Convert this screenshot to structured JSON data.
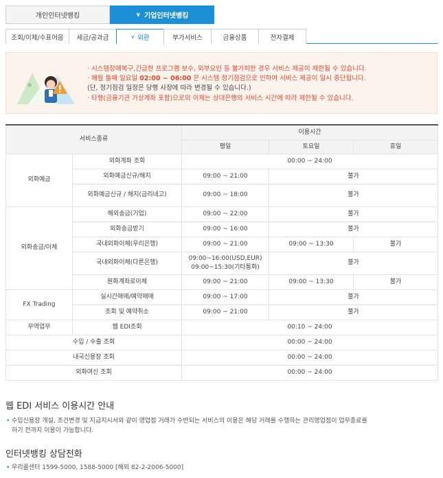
{
  "top_tabs": [
    {
      "label": "개인인터넷뱅킹",
      "active": false
    },
    {
      "label": "기업인터넷뱅킹",
      "active": true
    }
  ],
  "sub_tabs": [
    {
      "label": "조회/이체/수표어음",
      "active": false
    },
    {
      "label": "세금/공과금",
      "active": false
    },
    {
      "label": "외환",
      "active": true
    },
    {
      "label": "부가서비스",
      "active": false
    },
    {
      "label": "금융상품",
      "active": false
    },
    {
      "label": "전자결제",
      "active": false
    }
  ],
  "notice": {
    "line1": "· 시스템장애복구,긴급한 프로그램 보수, 외부요인 등 불가피한 경우 서비스 제공이 제한될 수 있습니다.",
    "line2_a": "· 매월 둘째 일요일 ",
    "line2_b": "02:00 ~ 06:00",
    "line2_c": " 은 시스템 정기점검으로 인하여 서비스 제공이 일시 중단됩니다.",
    "line3": "(단, 정기점검 일정은 당행 사정에 따라 변경될 수 있습니다.)",
    "line4": "· 타행(금융기관 가상계좌 포함)으로의 이체는 상대은행의 서비스 시간에 따라 제한될 수 있습니다."
  },
  "table": {
    "col_service": "서비스종류",
    "col_hours": "이용시간",
    "col_weekday": "평일",
    "col_saturday": "토요일",
    "col_holiday": "휴일",
    "groups": {
      "fx_deposit": "외화예금",
      "fx_remit": "외화송금/이체",
      "fx_trading": "FX Trading",
      "trade": "무역업무"
    },
    "rows": {
      "r1": {
        "service": "외화계좌 조회",
        "all": "00:00 ~ 24:00"
      },
      "r2": {
        "service": "외화예금신규/해지",
        "weekday": "09:00 ~ 21:00",
        "rest": "불가"
      },
      "r3": {
        "service": "외화예금신규 / 해지(금리네고)",
        "weekday": "09:00 ~ 18:00",
        "rest": "불가"
      },
      "r4": {
        "service": "해외송금(기업)",
        "weekday": "09:00 ~ 22:00",
        "rest": "불가"
      },
      "r5": {
        "service": "외화송금받기",
        "weekday": "09:00 ~ 16:00",
        "rest": "불가"
      },
      "r6": {
        "service": "국내외화이체(우리은행)",
        "weekday": "09:00 ~ 21:00",
        "saturday": "09:00 ~ 13:30",
        "holiday": "불가"
      },
      "r7": {
        "service": "국내외화이체(다른은행)",
        "weekday_1": "09:00~16:00(USD,EUR)",
        "weekday_2": "09:00~15:30(기타통화)",
        "rest": "불가"
      },
      "r8": {
        "service": "원화계좌로이체",
        "weekday": "09:00 ~ 21:00",
        "saturday": "09:00 ~ 13:30",
        "holiday": "불가"
      },
      "r9": {
        "service": "실시간매매/예약매매",
        "weekday": "09:00 ~ 17:00",
        "rest": "불가"
      },
      "r10": {
        "service": "조회 및 예약취소",
        "weekday": "09:00 ~ 21:00",
        "rest": "불가"
      },
      "r11": {
        "service": "웹 EDI조회",
        "all": "00:10 ~ 24:00"
      },
      "r12": {
        "service": "수입 / 수출 조회",
        "all": "00:00 ~ 24:00"
      },
      "r13": {
        "service": "내국신용장 조회",
        "all": "00:00 ~ 24:00"
      },
      "r14": {
        "service": "외화여신 조회",
        "all": "00:00 ~ 24:00"
      }
    }
  },
  "edi_section": {
    "title": "웹 EDI 서비스 이용시간 안내",
    "text_1": "수입신용장 개설, 조건변경 및 지급지시서와 같이 영업점 거래가 수반되는 서비스의 이용은 해당 거래를 수행하는 관리영업점이 업무종료를",
    "text_2": "하기 전까지 이용이 가능합니다."
  },
  "call_section": {
    "title": "인터넷뱅킹 상담전화",
    "text": "우리콜센터 1599-5000, 1588-5000 [해외 82-2-2006-5000]"
  },
  "colors": {
    "accent": "#1c8fd6",
    "notice_red": "#e8462b",
    "notice_bg": "#fdf3ed"
  }
}
